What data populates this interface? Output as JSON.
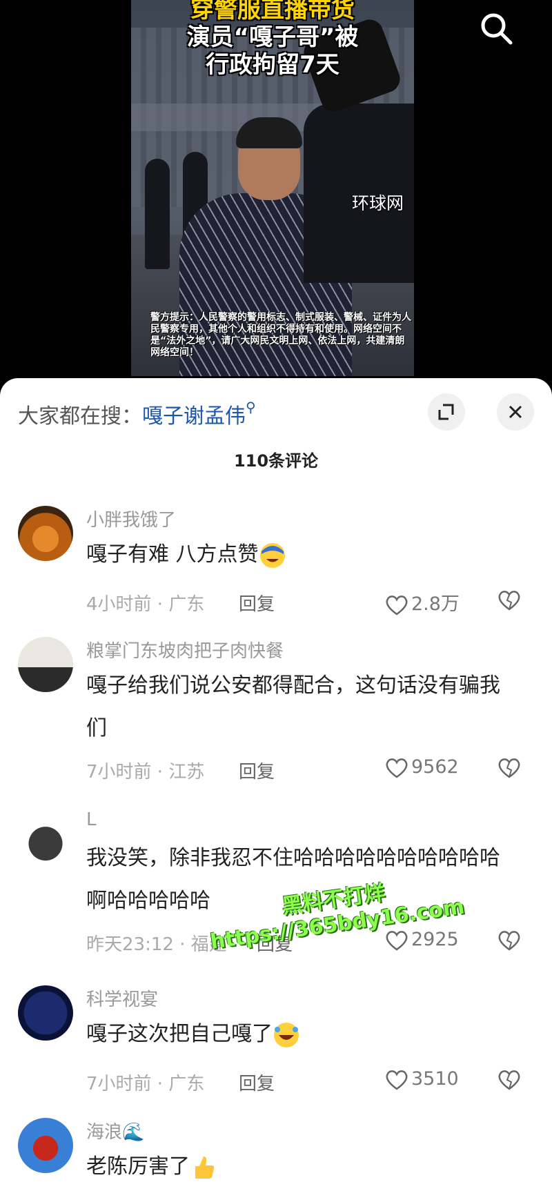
{
  "video": {
    "headline_line1": "穿警服直播带货",
    "headline_line2": "演员“嘎子哥”被",
    "headline_line3": "行政拘留7天",
    "watermark": "环球网",
    "notice": "警方提示：人民警察的警用标志、制式服装、警械、证件为人民警察专用，其他个人和组织不得持有和使用。网络空间不是“法外之地”，请广大网民文明上网、依法上网，共建清朗网络空间！",
    "search_icon": "search-icon"
  },
  "sheet": {
    "hot_label": "大家都在搜：",
    "hot_keyword": "嘎子谢孟伟",
    "hot_icon": "search-icon",
    "expand_icon": "expand-icon",
    "close_icon": "close-icon",
    "comment_count": "110条评论"
  },
  "comments": [
    {
      "user": "小胖我饿了",
      "text": "嘎子有难 八方点赞",
      "emoji": "laughing-sweat-emoji",
      "time": "4小时前 · 广东",
      "reply": "回复",
      "likes": "2.8万"
    },
    {
      "user": "粮掌门东坡肉把子肉快餐",
      "text": "嘎子给我们说公安都得配合，这句话没有骗我们",
      "time": "7小时前 · 江苏",
      "reply": "回复",
      "likes": "9562"
    },
    {
      "user": "L",
      "text": "我没笑，除非我忍不住哈哈哈哈哈哈哈哈哈哈啊哈哈哈哈哈",
      "time": "昨天23:12 · 福建",
      "reply": "回复",
      "likes": "2925"
    },
    {
      "user": "科学视宴",
      "text": "嘎子这次把自己嘎了",
      "emoji": "rofl-emoji",
      "time": "7小时前 · 广东",
      "reply": "回复",
      "likes": "3510"
    },
    {
      "user": "海浪🌊",
      "text": "老陈厉害了",
      "emoji": "thumbs-up-emoji"
    }
  ],
  "overlay_watermark": {
    "line1": "黑料不打烊",
    "line2": "https://365bdy16.com"
  },
  "colors": {
    "keyword": "#1d57a8",
    "watermark_green": "#8cff4c"
  }
}
